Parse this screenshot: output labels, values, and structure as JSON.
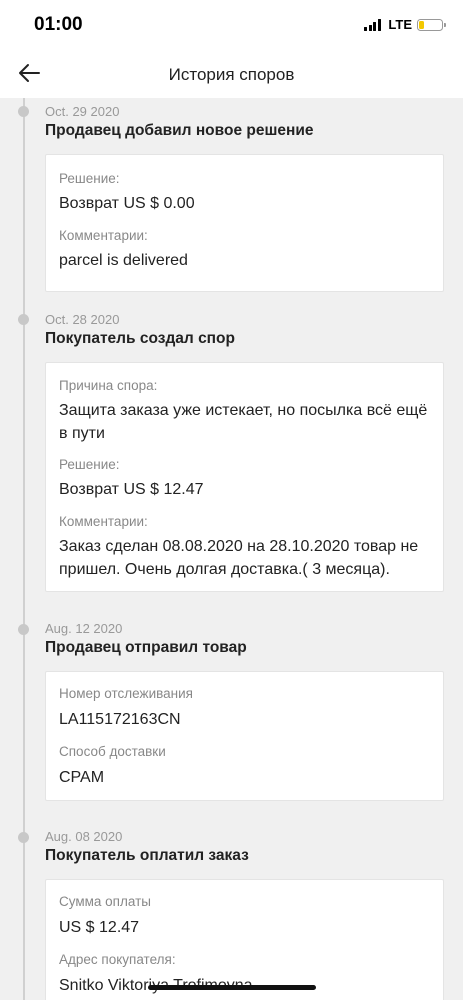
{
  "status": {
    "time": "01:00",
    "network": "LTE"
  },
  "header": {
    "title": "История споров"
  },
  "events": [
    {
      "date": "Oct. 29 2020",
      "title": "Продавец добавил новое решение",
      "fields": [
        {
          "label": "Решение:",
          "value": "Возврат US $ 0.00"
        },
        {
          "label": "Комментарии:",
          "value": "parcel is delivered"
        }
      ]
    },
    {
      "date": "Oct. 28 2020",
      "title": "Покупатель создал спор",
      "fields": [
        {
          "label": "Причина спора:",
          "value": "Защита заказа уже истекает, но посылка всё ещё в пути"
        },
        {
          "label": "Решение:",
          "value": "Возврат US $ 12.47"
        },
        {
          "label": "Комментарии:",
          "value": "Заказ сделан 08.08.2020 на 28.10.2020 товар не пришел. Очень долгая доставка.( 3 месяца)."
        }
      ]
    },
    {
      "date": "Aug. 12 2020",
      "title": "Продавец отправил товар",
      "fields": [
        {
          "label": "Номер отслеживания",
          "value": "LA115172163CN"
        },
        {
          "label": "Способ доставки",
          "value": "CPAM"
        }
      ]
    },
    {
      "date": "Aug. 08 2020",
      "title": "Покупатель оплатил заказ",
      "fields": [
        {
          "label": "Сумма оплаты",
          "value": "US $ 12.47"
        },
        {
          "label": "Адрес покупателя:",
          "value": "Snitko Viktoriya Trofimovna"
        }
      ]
    }
  ]
}
